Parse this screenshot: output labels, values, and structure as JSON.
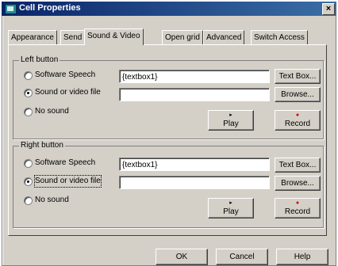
{
  "window": {
    "title": "Cell Properties",
    "close_glyph": "×"
  },
  "tabs": [
    "Appearance",
    "Send",
    "Sound & Video",
    "Open grid",
    "Advanced",
    "Switch Access"
  ],
  "active_tab": "Sound & Video",
  "left_group": {
    "label": "Left button",
    "options": [
      "Software Speech",
      "Sound or video file",
      "No sound"
    ],
    "selected": "Sound or video file",
    "speech_value": "{textbox1}",
    "file_value": "",
    "textbox_button": "Text Box...",
    "browse_button": "Browse...",
    "play_button": "Play",
    "record_button": "Record"
  },
  "right_group": {
    "label": "Right button",
    "options": [
      "Software Speech",
      "Sound or video file",
      "No sound"
    ],
    "selected": "Sound or video file",
    "speech_value": "{textbox1}",
    "file_value": "",
    "textbox_button": "Text Box...",
    "browse_button": "Browse...",
    "play_button": "Play",
    "record_button": "Record"
  },
  "icons": {
    "play": "▸",
    "record": "●"
  },
  "footer": {
    "ok": "OK",
    "cancel": "Cancel",
    "help": "Help"
  }
}
